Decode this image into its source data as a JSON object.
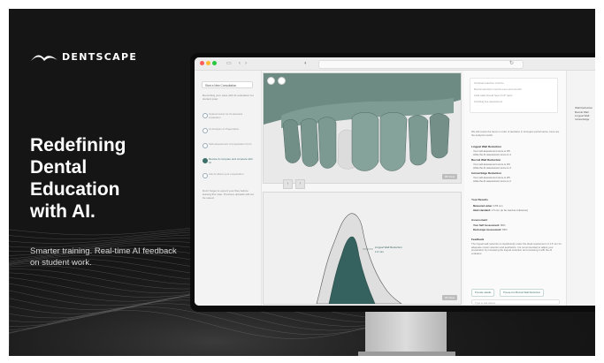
{
  "brand": {
    "logo_icon": "mountain-swoosh-icon",
    "name": "DENTSCAPE"
  },
  "hero": {
    "headline_lines": [
      "Redefining",
      "Dental",
      "Education",
      "with AI."
    ],
    "subline": "Smarter training. Real-time AI feedback on student work."
  },
  "colors": {
    "panel_bg": "#151515",
    "accent_teal": "#3c6f6a",
    "tooth_green": "#6f8c84",
    "prep_fill": "#35625e"
  },
  "app": {
    "sidebar": {
      "start_button": "Start a New Consultation",
      "note": "Recording your case with AI evaluation for student prep",
      "steps": [
        "Upload scans for AI-assisted evaluation",
        "AI Analysis of Preparation",
        "Self-assessment of preparation form",
        "Review & compare and compare with AI",
        "Ask AI about your preparation"
      ],
      "active_step": 3,
      "footer_note": "Don't forget to export your files before leaving this step. Previous uploads will not be saved."
    },
    "viewports": {
      "top_badge": "3D View",
      "bottom_badge": "2D View",
      "section_label": "Lingual Wall Reduction",
      "section_value": "1.0 mm"
    },
    "feedback": {
      "checklist": [
        "Occlusal reduction must be",
        "Buccal reduction must be even and smooth",
        "Axial walls should have 6-10° taper",
        "Finishing line assessment"
      ],
      "intro": "We will review the items in order of deviation in strongest performance. Here are the analysis results:",
      "sections": [
        {
          "title": "Lingual Wall Reduction",
          "lines": [
            "Your self-assessment score is 3/5",
            "while the AI assessment score is 4"
          ]
        },
        {
          "title": "Buccal Wall Reduction",
          "lines": [
            "Your self-assessment score is 4/5",
            "while the AI assessment score is 3"
          ]
        },
        {
          "title": "Incisal Edge Reduction",
          "lines": [
            "Your self-assessment score is 2/5",
            "while the AI assessment score is 2"
          ]
        }
      ],
      "results_title": "Your Results",
      "results": [
        {
          "label": "Measured value:",
          "value": "0.55 mm"
        },
        {
          "label": "Ideal standard:",
          "value": "1.5 mm (to be used as reference)"
        }
      ],
      "assessment_title": "Assessment",
      "assessment": [
        {
          "label": "Your Self Assessment:",
          "value": "80%"
        },
        {
          "label": "Dentscape Assessment:",
          "value": "65%"
        }
      ],
      "feedback_title": "Feedback",
      "feedback_text": "The lingual wall reduction is significantly under the ideal requirement of 1.5 mm for adequate crown retention and aesthetics. It is recommended to adjust your preparation by increasing the lingual reduction and reviewing it with the AI evaluator.",
      "buttons": [
        "Provide details",
        "Proceed to Buccal Wall Reduction"
      ],
      "input_placeholder": "Type to ask Helper"
    },
    "far_panel": {
      "title": "Wall Reduction",
      "items": [
        "Buccal Wall",
        "Lingual Wall",
        "Incisal Edge"
      ]
    }
  }
}
